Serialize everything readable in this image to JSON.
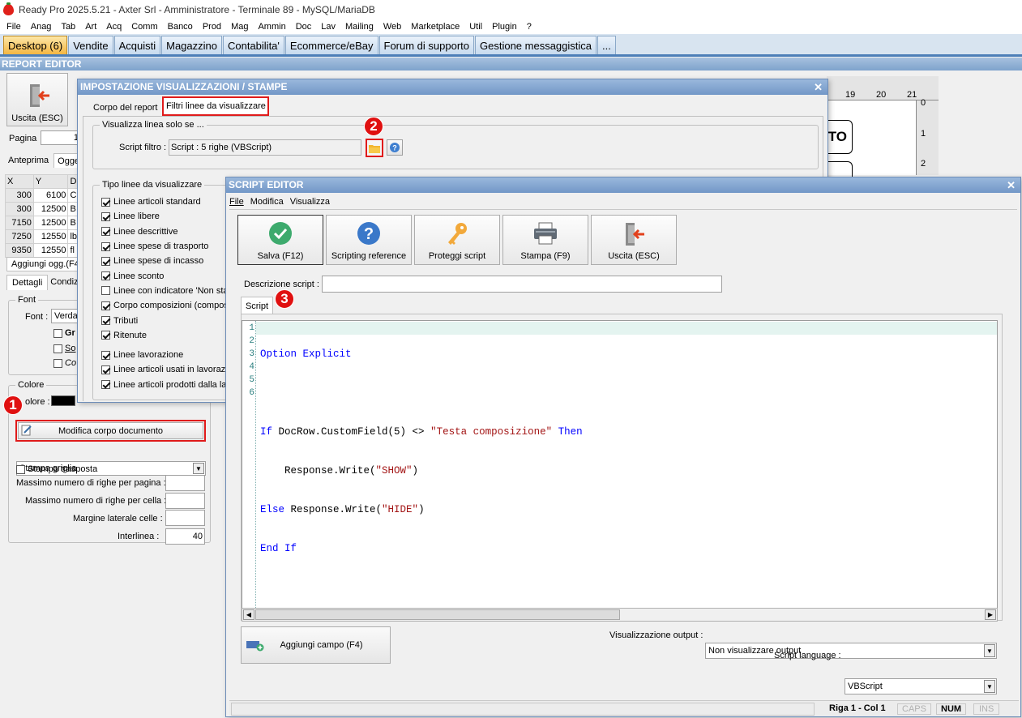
{
  "window": {
    "title": "Ready Pro 2025.5.21 - Axter Srl - Amministratore - Terminale 89 - MySQL/MariaDB"
  },
  "menu": [
    "File",
    "Anag",
    "Tab",
    "Art",
    "Acq",
    "Comm",
    "Banco",
    "Prod",
    "Mag",
    "Ammin",
    "Doc",
    "Lav",
    "Mailing",
    "Web",
    "Marketplace",
    "Util",
    "Plugin",
    "?"
  ],
  "tabs": [
    "Desktop (6)",
    "Vendite",
    "Acquisti",
    "Magazzino",
    "Contabilita'",
    "Ecommerce/eBay",
    "Forum di supporto",
    "Gestione messaggistica",
    "..."
  ],
  "report": {
    "title": "REPORT EDITOR",
    "exit_label": "Uscita (ESC)",
    "page_label": "Pagina",
    "page_value": "1",
    "subtabs": [
      "Anteprima",
      "Ogge"
    ],
    "grid": {
      "headers": [
        "X",
        "Y",
        "D"
      ],
      "rows": [
        [
          "300",
          "6100",
          "C"
        ],
        [
          "300",
          "12500",
          "B"
        ],
        [
          "7150",
          "12500",
          "B"
        ],
        [
          "7250",
          "12550",
          "lb"
        ],
        [
          "9350",
          "12550",
          "fl"
        ]
      ]
    },
    "add_obj": "Aggiungi ogg.(F4",
    "detail_tabs": [
      "Dettagli",
      "Condiz"
    ],
    "font_group": "Font",
    "font_label": "Font :",
    "font_value": "Verda",
    "style_labels": [
      "Gr",
      "So",
      "Co"
    ],
    "color_group": "Colore",
    "color_label": "olore :",
    "edit_body_label": "Modifica corpo documento",
    "print_grid": "Stampa griglia",
    "transpose_label": "Stampa trasposta",
    "max_rows_page": "Massimo numero di righe per pagina :",
    "max_rows_cell": "Massimo numero di righe per cella :",
    "side_margin": "Margine laterale celle :",
    "line_spacing": "Interlinea :",
    "line_spacing_value": "40"
  },
  "ruler": {
    "h_labels": [
      "19",
      "20",
      "21"
    ],
    "v_labels": [
      "0",
      "1",
      "2"
    ],
    "box_text": "TO"
  },
  "settings_dialog": {
    "title": "IMPOSTAZIONE VISUALIZZAZIONI / STAMPE",
    "tabs": [
      "Corpo del report",
      "Filtri linee da visualizzare"
    ],
    "group1": "Visualizza linea solo se ...",
    "script_label": "Script filtro :",
    "script_value": "Script : 5 righe (VBScript)",
    "group2": "Tipo linee da visualizzare",
    "line_types": [
      {
        "label": "Linee articoli standard",
        "checked": true
      },
      {
        "label": "Linee libere",
        "checked": true
      },
      {
        "label": "Linee descrittive",
        "checked": true
      },
      {
        "label": "Linee spese di trasporto",
        "checked": true
      },
      {
        "label": "Linee spese di incasso",
        "checked": true
      },
      {
        "label": "Linee sconto",
        "checked": true
      },
      {
        "label": "Linee con indicatore 'Non sta",
        "checked": false
      },
      {
        "label": "Corpo composizioni (composiz",
        "checked": true
      },
      {
        "label": "Tributi",
        "checked": true
      },
      {
        "label": "Ritenute",
        "checked": true
      },
      {
        "label": "Linee lavorazione",
        "checked": true
      },
      {
        "label": "Linee articoli usati in lavorazio",
        "checked": true
      },
      {
        "label": "Linee articoli prodotti dalla lav",
        "checked": true
      }
    ]
  },
  "script_editor": {
    "title": "SCRIPT EDITOR",
    "menu": [
      "File",
      "Modifica",
      "Visualizza"
    ],
    "toolbar": {
      "save": "Salva (F12)",
      "reference": "Scripting reference",
      "protect": "Proteggi script",
      "print": "Stampa (F9)",
      "exit": "Uscita (ESC)"
    },
    "desc_label": "Descrizione script :",
    "desc_value": "",
    "tab": "Script",
    "line_numbers": [
      "1",
      "2",
      "3",
      "4",
      "5",
      "6"
    ],
    "code": {
      "l1_kw": "Option Explicit",
      "l3_if": "If",
      "l3_mid": " DocRow.CustomField(5) <> ",
      "l3_str": "\"Testa composizione\"",
      "l3_then": " Then",
      "l4_pre": "    Response.Write(",
      "l4_str": "\"SHOW\"",
      "l4_post": ")",
      "l5_else": "Else",
      "l5_mid": " Response.Write(",
      "l5_str": "\"HIDE\"",
      "l5_post": ")",
      "l6_end": "End",
      "l6_if": "If"
    },
    "add_field": "Aggiungi campo (F4)",
    "output_label": "Visualizzazione output :",
    "output_value": "Non visualizzare output",
    "lang_label": "Script language :",
    "lang_value": "VBScript",
    "status": {
      "pos": "Riga 1 - Col 1",
      "caps": "CAPS",
      "num": "NUM",
      "ins": "INS"
    }
  },
  "badges": [
    "1",
    "2",
    "3"
  ],
  "colors": {
    "accent_red": "#e01b1b",
    "title_blue": "#7297c7",
    "keyword": "#0000ff",
    "string": "#a31515"
  }
}
